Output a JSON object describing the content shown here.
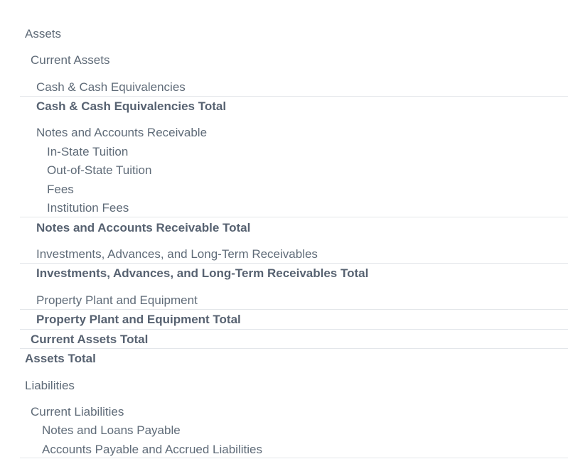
{
  "rows": {
    "assets": "Assets",
    "current_assets": "Current Assets",
    "cash": "Cash & Cash Equivalencies",
    "cash_total": "Cash & Cash Equivalencies Total",
    "notes_ar": "Notes and Accounts Receivable",
    "in_state": "In-State Tuition",
    "out_state": "Out-of-State Tuition",
    "fees": "Fees",
    "institution_fees": "Institution Fees",
    "notes_ar_total": "Notes and Accounts Receivable Total",
    "investments": "Investments, Advances, and Long-Term Receivables",
    "investments_total": "Investments, Advances, and Long-Term Receivables Total",
    "ppe": "Property Plant and Equipment",
    "ppe_total": "Property Plant and Equipment Total",
    "current_assets_total": "Current Assets Total",
    "assets_total": "Assets Total",
    "liabilities": "Liabilities",
    "current_liabilities": "Current Liabilities",
    "notes_loans": "Notes and Loans Payable",
    "accounts_payable": "Accounts Payable and Accrued Liabilities"
  }
}
